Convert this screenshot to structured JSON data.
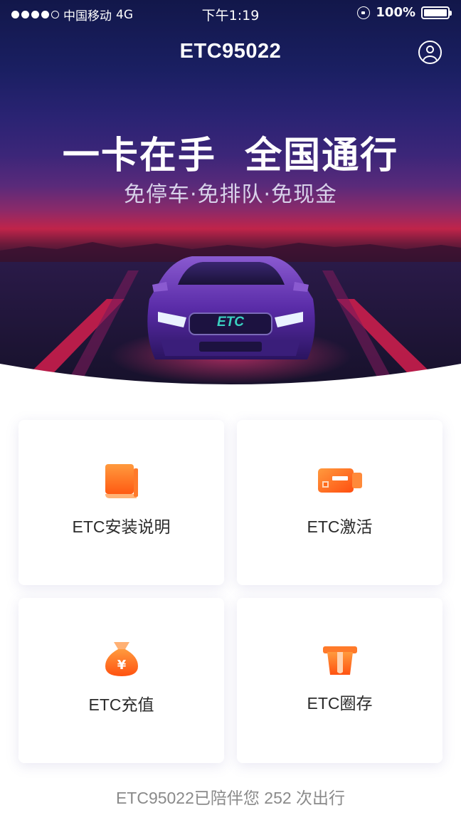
{
  "status_bar": {
    "carrier": "中国移动",
    "network": "4G",
    "time": "下午1:19",
    "battery": "100%"
  },
  "nav": {
    "title": "ETC95022",
    "profile_icon": "user-circle-icon"
  },
  "hero": {
    "headline": "一卡在手  全国通行",
    "subline": "免停车·免排队·免现金",
    "plate_text": "ETC"
  },
  "cards": [
    {
      "label": "ETC安装说明",
      "icon": "book-icon"
    },
    {
      "label": "ETC激活",
      "icon": "etc-device-icon"
    },
    {
      "label": "ETC充值",
      "icon": "money-bag-icon"
    },
    {
      "label": "ETC圈存",
      "icon": "card-slot-icon"
    }
  ],
  "footer": {
    "text": "ETC95022已陪伴您 252 次出行"
  },
  "colors": {
    "accent_orange": "#ff6a1a",
    "accent_orange_light": "#ffb073",
    "hero_navy": "#12174a",
    "hero_red": "#c0244a"
  }
}
